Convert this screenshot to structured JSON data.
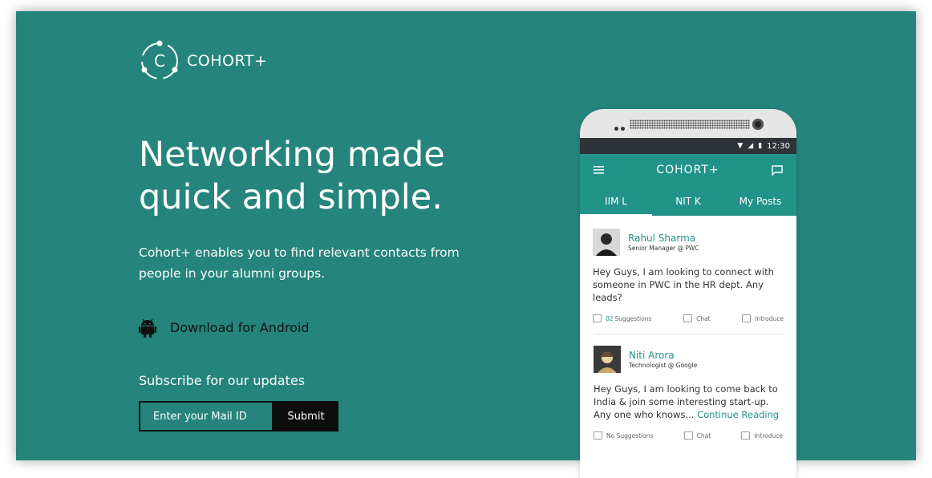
{
  "brand": {
    "name": "COHORT+",
    "color": "#25857c",
    "logo_icon": "cohort-logo-icon"
  },
  "hero": {
    "headline": "Networking made quick and simple.",
    "subtitle": "Cohort+ enables you to find relevant contacts from people in your alumni groups."
  },
  "download": {
    "label": "Download for Android",
    "icon": "android-icon"
  },
  "subscribe": {
    "label": "Subscribe for our updates",
    "input_placeholder": "Enter your Mail ID",
    "input_value": "",
    "submit_label": "Submit"
  },
  "phone": {
    "status_time": "12:30",
    "app_title": "COHORT+",
    "tabs": [
      {
        "label": "IIM L",
        "active": true
      },
      {
        "label": "NIT K",
        "active": false
      },
      {
        "label": "My Posts",
        "active": false
      }
    ],
    "posts": [
      {
        "name": "Rahul Sharma",
        "role": "Senior Manager @ PWC",
        "message": "Hey Guys, I am looking to connect with someone in PWC in the HR dept. Any leads?",
        "more": "",
        "suggestions_count": "02",
        "suggestions_label": "Suggestions",
        "chat_label": "Chat",
        "introduce_label": "Introduce"
      },
      {
        "name": "Niti Arora",
        "role": "Technologist @ Google",
        "message": "Hey Guys, I am looking to come back to India & join some interesting start-up. Any one who knows...",
        "more": "Continue Reading",
        "suggestions_count": "",
        "suggestions_label": "No Suggestions",
        "chat_label": "Chat",
        "introduce_label": "Introduce"
      }
    ]
  }
}
